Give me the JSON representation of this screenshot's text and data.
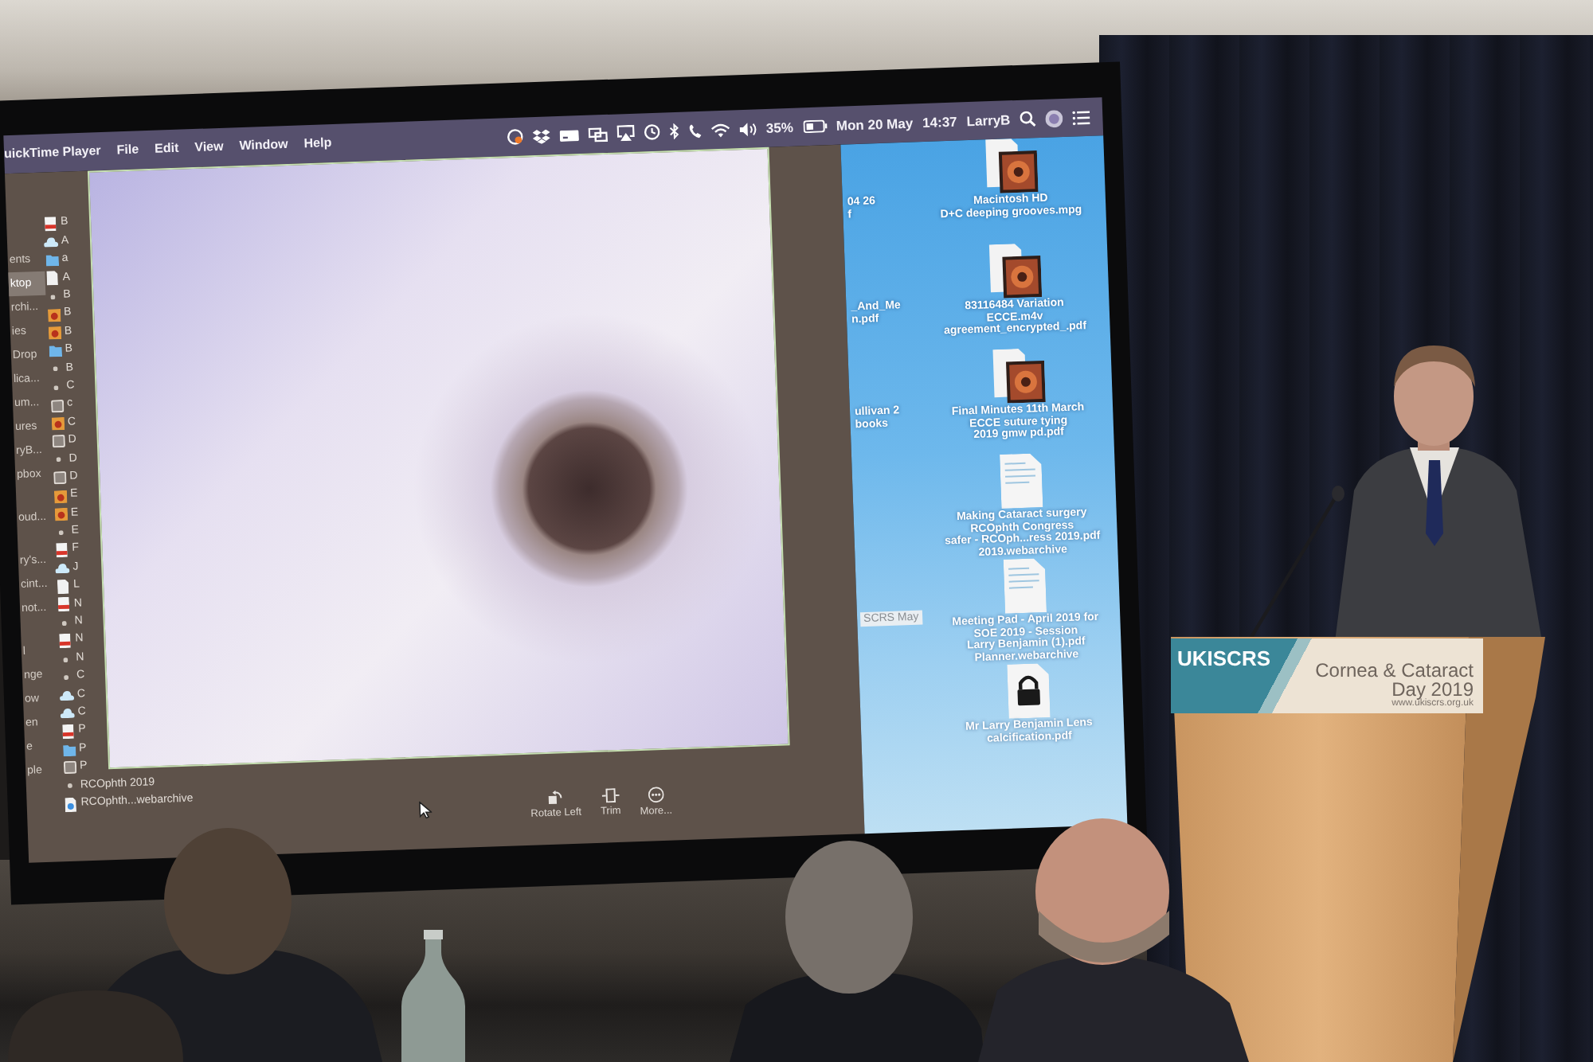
{
  "projected_screen": {
    "menu_bar": {
      "app_name": "uickTime Player",
      "menus": [
        "File",
        "Edit",
        "View",
        "Window",
        "Help"
      ],
      "battery": "35%",
      "date": "Mon 20 May",
      "time": "14:37",
      "user": "LarryB"
    },
    "finder_sidebar": [
      {
        "items": [
          {
            "label": "ents",
            "selected": false
          },
          {
            "label": "ktop",
            "selected": true
          },
          {
            "label": "rchi...",
            "selected": false
          },
          {
            "label": "ies",
            "selected": false
          },
          {
            "label": "Drop",
            "selected": false
          },
          {
            "label": "lica...",
            "selected": false
          },
          {
            "label": "um...",
            "selected": false
          },
          {
            "label": "ures",
            "selected": false
          },
          {
            "label": "ryB...",
            "selected": false
          },
          {
            "label": "pbox",
            "selected": false
          }
        ]
      },
      {
        "items": [
          {
            "label": "oud...",
            "selected": false
          }
        ]
      },
      {
        "items": [
          {
            "label": "ry's...",
            "selected": false
          },
          {
            "label": "cint...",
            "selected": false
          },
          {
            "label": "not...",
            "selected": false
          }
        ]
      },
      {
        "items": [
          {
            "label": "l",
            "selected": false
          },
          {
            "label": "nge",
            "selected": false
          },
          {
            "label": "ow",
            "selected": false
          },
          {
            "label": "en",
            "selected": false
          },
          {
            "label": "e",
            "selected": false
          },
          {
            "label": "ple",
            "selected": false
          }
        ]
      }
    ],
    "file_list": [
      {
        "kind": "pdf",
        "name": "B"
      },
      {
        "kind": "cloud",
        "name": "A"
      },
      {
        "kind": "folder",
        "name": "a"
      },
      {
        "kind": "doc",
        "name": "A"
      },
      {
        "kind": "blank",
        "name": "B"
      },
      {
        "kind": "image",
        "name": "B"
      },
      {
        "kind": "image",
        "name": "B"
      },
      {
        "kind": "folder",
        "name": "B"
      },
      {
        "kind": "blank",
        "name": "B"
      },
      {
        "kind": "blank",
        "name": "C"
      },
      {
        "kind": "app",
        "name": "c"
      },
      {
        "kind": "image",
        "name": "C"
      },
      {
        "kind": "app",
        "name": "D"
      },
      {
        "kind": "blank",
        "name": "D"
      },
      {
        "kind": "app",
        "name": "D"
      },
      {
        "kind": "image",
        "name": "E"
      },
      {
        "kind": "image",
        "name": "E"
      },
      {
        "kind": "blank",
        "name": "E"
      },
      {
        "kind": "pdf",
        "name": "F"
      },
      {
        "kind": "cloud",
        "name": "J"
      },
      {
        "kind": "doc",
        "name": "L"
      },
      {
        "kind": "pdf",
        "name": "N"
      },
      {
        "kind": "blank",
        "name": "N"
      },
      {
        "kind": "pdf",
        "name": "N"
      },
      {
        "kind": "blank",
        "name": "N"
      },
      {
        "kind": "blank",
        "name": "C"
      },
      {
        "kind": "cloud",
        "name": "C"
      },
      {
        "kind": "cloud",
        "name": "C"
      },
      {
        "kind": "pdf",
        "name": "P"
      },
      {
        "kind": "folder",
        "name": "P"
      },
      {
        "kind": "app",
        "name": "P"
      },
      {
        "kind": "blank",
        "name": "RCOphth 2019"
      },
      {
        "kind": "webarchive",
        "name": "RCOphth...webarchive"
      }
    ],
    "player_controls": [
      {
        "kind": "rotate",
        "label": "Rotate Left"
      },
      {
        "kind": "trim",
        "label": "Trim"
      },
      {
        "kind": "more",
        "label": "More..."
      }
    ],
    "desktop": {
      "partial_labels": [
        [
          "04 26",
          "f"
        ],
        [
          "_And_Me",
          "n.pdf"
        ],
        [
          "ullivan 2",
          "books"
        ]
      ],
      "highlighted_label": "SCRS May",
      "icons": [
        {
          "kind": "video",
          "labels": [
            "Macintosh HD",
            "D+C deeping grooves.mpg"
          ]
        },
        {
          "kind": "video",
          "labels": [
            "83116484 Variation",
            "ECCE.m4v",
            "agreement_encrypted_.pdf"
          ]
        },
        {
          "kind": "video",
          "labels": [
            "Final Minutes 11th March",
            "ECCE suture tying",
            "2019 gmw pd.pdf"
          ]
        },
        {
          "kind": "document",
          "labels": [
            "Making Cataract surgery",
            "RCOphth Congress",
            "safer - RCOph...ress 2019.pdf",
            "2019.webarchive"
          ]
        },
        {
          "kind": "document",
          "labels": [
            "Meeting Pad - April 2019 for",
            "SOE 2019 - Session",
            "Larry Benjamin (1).pdf",
            "Planner.webarchive"
          ]
        },
        {
          "kind": "locked",
          "labels": [
            "Mr Larry Benjamin Lens",
            "calcification.pdf"
          ]
        }
      ]
    }
  },
  "podium_sign": {
    "logo": "UKISCRS",
    "title": "Cornea & Cataract Day 2019",
    "website": "www.ukiscrs.org.uk"
  }
}
